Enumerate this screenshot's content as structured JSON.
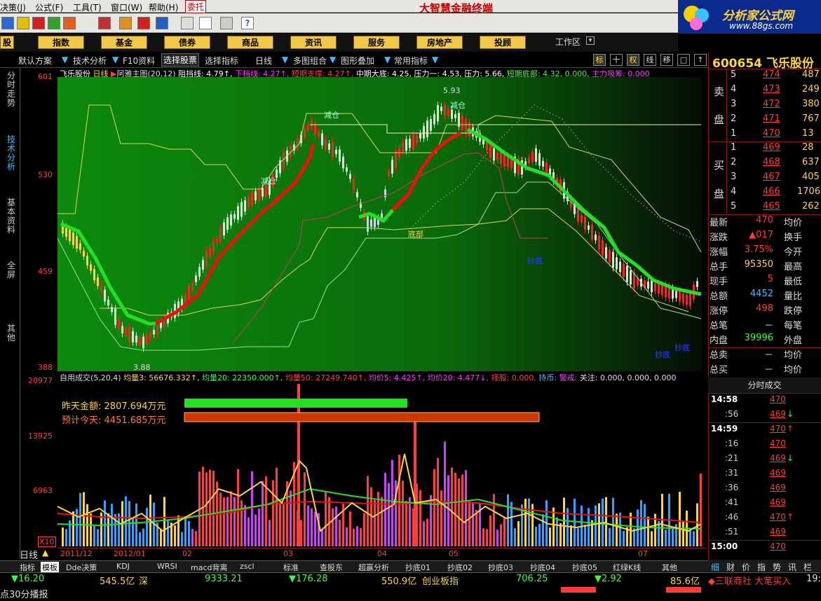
{
  "menu": {
    "items": [
      "决策(J)",
      "公式(F)",
      "工具(T)",
      "窗口(W)",
      "帮助(H)"
    ],
    "active_item": "委托",
    "app_title": "大智慧金融终端"
  },
  "logo": {
    "text": "分析家公式网",
    "url": "www.88gs.com"
  },
  "sections": [
    "股",
    "指数",
    "基金",
    "债券",
    "商品",
    "资讯",
    "服务",
    "房地产",
    "投顾"
  ],
  "workarea_label": "工作区",
  "chart_tabs": [
    "默认方案",
    "技术分析",
    "F10资料",
    "选择股票",
    "选择指标",
    "日线",
    "多图组合",
    "图形叠加",
    "常用指标"
  ],
  "chart_buttons": [
    "标",
    "十",
    "权",
    "线",
    "移",
    "□",
    "↑"
  ],
  "left_tabs": [
    "分时走势",
    "技术分析",
    "基本资料",
    "全屏",
    "其他"
  ],
  "price_axis": [
    "601",
    "530",
    "459",
    "388"
  ],
  "volume_axis": [
    "20977",
    "13925",
    "6963",
    "X10"
  ],
  "price_info": {
    "name": "飞乐股份",
    "period": "日线",
    "indicator": "阿雅主图(20,12)",
    "zudang": "阻挡线: 4.79",
    "xiadang": "下档线: 4.27",
    "duanqi": "短期支撑: 4.27",
    "zhongqi": "中期大底: 4.25,",
    "yali1": "压力一: 4.53,",
    "yali": "压力: 5.66,",
    "duanqidi": "短期底部: 4.32, 0.000,",
    "zhuli": "主力吸筹: 0.000"
  },
  "chart_labels": {
    "jiancang": "减仓",
    "dibu": "底部",
    "chaodi": "抄底",
    "high": "5.93",
    "low": "3.88"
  },
  "volume_info": {
    "name": "自用成交(5,20,4)",
    "ma3": "均量3: 56676.332",
    "ma20": "均量20: 22350.000",
    "ma50": "均量50: 27249.740",
    "avg5": "均价5: 4.425",
    "avg20": "均价20: 4.477",
    "zegu": "择股: 0.000,",
    "chishi": "持币:",
    "jingjie": "警戒:",
    "guanzhu": "关注: 0.000, 0.000, 0.000"
  },
  "money": {
    "yesterday_label": "昨天金额:",
    "yesterday_value": "2807.694万元",
    "today_label": "预计今天:",
    "today_value": "4451.685万元"
  },
  "dates": [
    "2011/12",
    "2012/01",
    "02",
    "03",
    "04",
    "05",
    "07"
  ],
  "period_label": "日线",
  "indicator_tabs": [
    "指标",
    "模板",
    "Dde决策",
    "KDJ",
    "WRSI",
    "macd背离",
    "zscl",
    "标准",
    "查股东",
    "超赢分析",
    "抄底01",
    "抄底02",
    "抄底03",
    "抄底04",
    "抄底05",
    "红绿K线",
    "其他"
  ],
  "quote": {
    "code": "600654 飞乐股份",
    "sell_label_1": "卖",
    "sell_label_2": "盘",
    "buy_label_1": "买",
    "buy_label_2": "盘",
    "sell": [
      {
        "level": "5",
        "price": "474",
        "vol": "487"
      },
      {
        "level": "4",
        "price": "473",
        "vol": "249"
      },
      {
        "level": "3",
        "price": "472",
        "vol": "380"
      },
      {
        "level": "2",
        "price": "471",
        "vol": "767"
      },
      {
        "level": "1",
        "price": "470",
        "vol": "13"
      }
    ],
    "buy": [
      {
        "level": "1",
        "price": "469",
        "vol": "28"
      },
      {
        "level": "2",
        "price": "468",
        "vol": "637"
      },
      {
        "level": "3",
        "price": "467",
        "vol": "405"
      },
      {
        "level": "4",
        "price": "466",
        "vol": "1706"
      },
      {
        "level": "5",
        "price": "465",
        "vol": "262"
      }
    ],
    "stats": [
      {
        "l": "最新",
        "v": "470",
        "r": "均价",
        "vc": "#ff3b3b"
      },
      {
        "l": "涨跌",
        "v": "▲017",
        "r": "换手",
        "vc": "#ff3b3b"
      },
      {
        "l": "涨幅",
        "v": "3.75%",
        "r": "今开",
        "vc": "#ff3b3b"
      },
      {
        "l": "总手",
        "v": "95350",
        "r": "最高",
        "vc": "#ffd53b"
      },
      {
        "l": "现手",
        "v": "5",
        "r": "最低",
        "vc": "#ff3b3b"
      },
      {
        "l": "总额",
        "v": "4452",
        "r": "量比",
        "vc": "#35c0ff"
      },
      {
        "l": "涨停",
        "v": "498",
        "r": "跌停",
        "vc": "#ff3b3b"
      },
      {
        "l": "总笔",
        "v": "－",
        "r": "每笔",
        "vc": "#ddd"
      },
      {
        "l": "内盘",
        "v": "39996",
        "r": "外盘",
        "vc": "#3bff3b"
      },
      {
        "l": "总卖",
        "v": "－",
        "r": "均价",
        "vc": "#ddd"
      },
      {
        "l": "总买",
        "v": "－",
        "r": "均价",
        "vc": "#ddd"
      }
    ],
    "tick_header": "分时成交",
    "ticks": [
      {
        "t": "14:58",
        "p": "470",
        "a": ""
      },
      {
        "t": ":56",
        "p": "469",
        "a": "down"
      },
      {
        "t": "14:59",
        "p": "470",
        "a": "up"
      },
      {
        "t": ":16",
        "p": "470",
        "a": ""
      },
      {
        "t": ":21",
        "p": "469",
        "a": "down"
      },
      {
        "t": ":31",
        "p": "469",
        "a": ""
      },
      {
        "t": ":36",
        "p": "469",
        "a": ""
      },
      {
        "t": ":41",
        "p": "469",
        "a": ""
      },
      {
        "t": ":46",
        "p": "470",
        "a": "up"
      },
      {
        "t": ":51",
        "p": "469",
        "a": ""
      },
      {
        "t": "15:00",
        "p": "470",
        "a": ""
      }
    ],
    "tabs": [
      "细",
      "财",
      "价",
      "指",
      "势",
      "讯",
      "栏"
    ]
  },
  "status": {
    "sh_change": "▼16.20",
    "sh_amount": "545.5亿",
    "sz_label": "深",
    "sz_index": "9333.21",
    "sz_change": "▼176.28",
    "sz_amount": "550.9亿",
    "cy_label": "创业板指",
    "cy_index": "706.25",
    "cy_change": "▼2.92",
    "cy_amount": "85.6亿",
    "news": "◆三联商社 大笔买入",
    "time": "19:",
    "broadcast": "点30分播报"
  }
}
